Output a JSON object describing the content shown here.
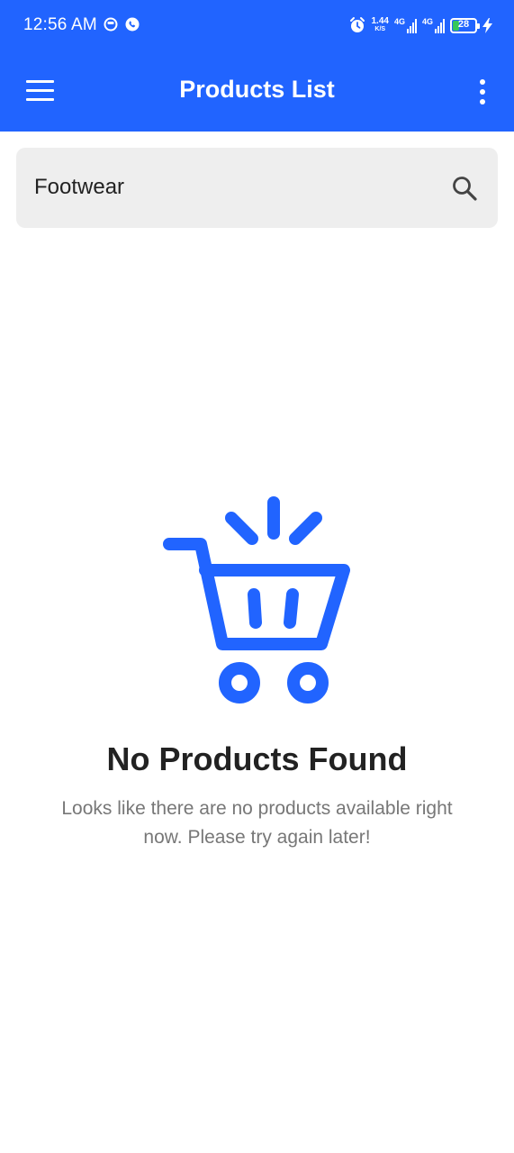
{
  "status_bar": {
    "time": "12:56 AM",
    "net_speed_value": "1.44",
    "net_speed_unit": "K/S",
    "signal_1_label": "4G",
    "signal_2_label": "4G",
    "battery_level": "28",
    "battery_fraction": 0.28
  },
  "app_bar": {
    "title": "Products List"
  },
  "search": {
    "value": "Footwear",
    "placeholder": ""
  },
  "empty_state": {
    "title": "No Products Found",
    "message": "Looks like there are no products available right now. Please try again later!"
  },
  "colors": {
    "primary": "#2164FF",
    "search_bg": "#EEEEEE",
    "title_text": "#222222",
    "message_text": "#777777"
  },
  "icons": {
    "menu": "hamburger-menu-icon",
    "more": "more-vertical-icon",
    "search": "search-icon",
    "empty": "shopping-cart-icon",
    "alarm": "alarm-icon",
    "battery": "battery-charging-icon"
  }
}
